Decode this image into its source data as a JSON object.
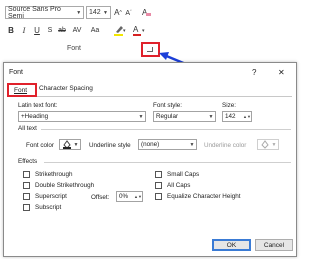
{
  "ribbon": {
    "font_name": "Source Sans Pro Semi",
    "font_size": "142",
    "group_label": "Font",
    "icons": [
      "bold-icon",
      "italic-icon",
      "underline-icon",
      "strikethrough-icon",
      "highlight-icon",
      "font-color-icon",
      "grow-font-icon",
      "shrink-font-icon",
      "clear-formatting-icon",
      "dialog-launcher-icon"
    ]
  },
  "colors": {
    "highlight_red": "#e0212b",
    "arrow_blue": "#1c3fd8",
    "font_color_red": "#d62222"
  },
  "dialog": {
    "title": "Font",
    "help": "?",
    "close": "✕",
    "tabs": [
      "Font",
      "Character Spacing"
    ],
    "latin_font_label": "Latin text font:",
    "latin_font_value": "+Heading",
    "style_label": "Font style:",
    "style_value": "Regular",
    "size_label": "Size:",
    "size_value": "142",
    "all_text_label": "All text",
    "font_color_label": "Font color",
    "underline_style_label": "Underline style",
    "underline_style_value": "(none)",
    "underline_color_label": "Underline color",
    "effects_label": "Effects",
    "effects_left": [
      "Strikethrough",
      "Double Strikethrough",
      "Superscript",
      "Subscript"
    ],
    "effects_right": [
      "Small Caps",
      "All Caps",
      "Equalize Character Height"
    ],
    "offset_label": "Offset:",
    "offset_value": "0%",
    "ok": "OK",
    "cancel": "Cancel"
  }
}
